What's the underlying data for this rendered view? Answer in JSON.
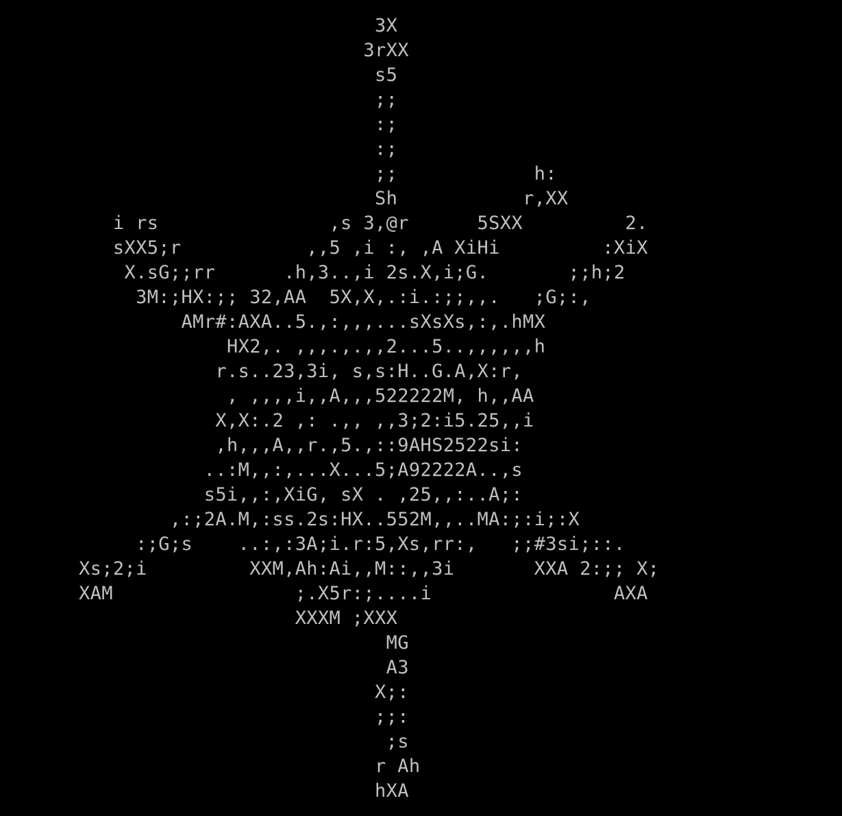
{
  "colors": {
    "background": "#000000",
    "text": "#c0c0c0"
  },
  "ascii_art": {
    "lines": [
      "                          3X",
      "                         3rXX",
      "                          s5",
      "                          ;;",
      "                          :;",
      "                          :;",
      "                          ;;            h:",
      "                          Sh           r,XX",
      "   i rs               ,s 3,@r      5SXX         2.",
      "   sXX5;r           ,,5 ,i :, ,A XiHi         :XiX",
      "    X.sG;;rr      .h,3..,i 2s.X,i;G.       ;;h;2",
      "     3M:;HX:;; 32,AA  5X,X,.:i.:;;,,.   ;G;:,",
      "         AMr#:AXA..5.,:,,,...sXsXs,:,.hMX",
      "             HX2,. ,,,.,.,,2...5..,,,,,,h",
      "            r.s..23,3i, s,s:H..G.A,X:r,",
      "             , ,,,,i,,A,,,522222M, h,,AA",
      "            X,X:.2 ,: .,, ,,3;2:i5.25,,i",
      "            ,h,,,A,,r.,5.,::9AHS2522si:",
      "           ..:M,,:,...X...5;A92222A..,s",
      "           s5i,,:,XiG, sX . ,25,,:..A;:",
      "        ,:;2A.M,:ss.2s:HX..552M,,..MA:;:i;:X",
      "     :;G;s    ..:,:3A;i.r:5,Xs,rr:,   ;;#3si;::.",
      "Xs;2;i         XXM,Ah:Ai,,M::,,3i       XXA 2:;; X;",
      "XAM                ;.X5r:;....i                AXA",
      "                   XXXM ;XXX",
      "                           MG",
      "                           A3",
      "                          X;:",
      "                          ;;:",
      "                           ;s",
      "                          r Ah",
      "                          hXA"
    ]
  }
}
